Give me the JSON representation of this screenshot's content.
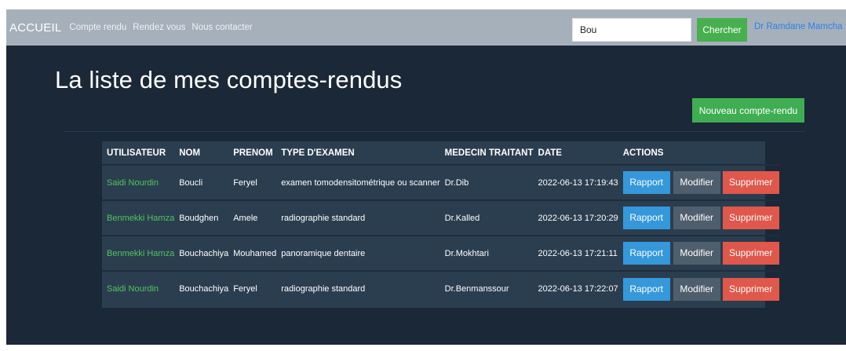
{
  "navbar": {
    "brand": "ACCUEIL",
    "links": [
      "Compte rendu",
      "Rendez vous",
      "Nous contacter"
    ],
    "search_value": "Bou",
    "search_button": "Chercher",
    "user": "Dr Ramdane Mamcha"
  },
  "main": {
    "title": "La liste de mes comptes-rendus",
    "new_button": "Nouveau compte-rendu"
  },
  "table": {
    "headers": [
      "UTILISATEUR",
      "NOM",
      "PRENOM",
      "TYPE D'EXAMEN",
      "MEDECIN TRAITANT",
      "DATE",
      "ACTIONS"
    ],
    "rows": [
      {
        "user": "Saidi Nourdin",
        "nom": "Boucli",
        "prenom": "Feryel",
        "type": "examen tomodensitométrique ou scanner",
        "medecin": "Dr.Dib",
        "date": "2022-06-13 17:19:43"
      },
      {
        "user": "Benmekki Hamza",
        "nom": "Boudghen",
        "prenom": "Amele",
        "type": "radiographie standard",
        "medecin": "Dr.Kalled",
        "date": "2022-06-13 17:20:29"
      },
      {
        "user": "Benmekki Hamza",
        "nom": "Bouchachiya",
        "prenom": "Mouhamed",
        "type": "panoramique dentaire",
        "medecin": "Dr.Mokhtari",
        "date": "2022-06-13 17:21:11"
      },
      {
        "user": "Saidi Nourdin",
        "nom": "Bouchachiya",
        "prenom": "Feryel",
        "type": "radiographie standard",
        "medecin": "Dr.Benmanssour",
        "date": "2022-06-13 17:22:07"
      }
    ],
    "actions": {
      "rapport": "Rapport",
      "modifier": "Modifier",
      "supprimer": "Supprimer"
    }
  },
  "colors": {
    "navbar_bg": "#a6b0bb",
    "main_bg": "#1b2838",
    "table_bg": "#2b3e50",
    "success": "#47b04e",
    "info": "#3498db",
    "danger": "#e0574b",
    "link_user": "#52c35c",
    "accent": "#2f82e6"
  }
}
